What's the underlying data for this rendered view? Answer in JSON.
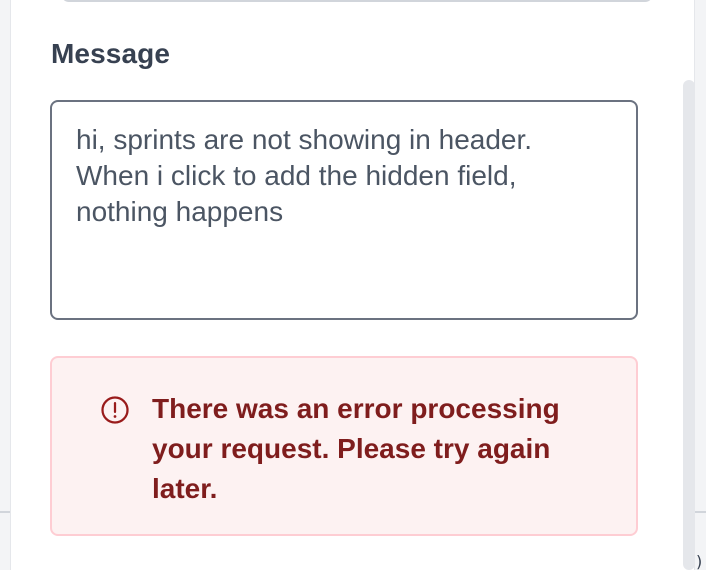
{
  "message_field": {
    "label": "Message",
    "value": "hi, sprints are not showing in header. When i click to add the hidden field, nothing happens"
  },
  "error_alert": {
    "text": "There was an error processing your request. Please try again later.",
    "icon": "exclamation-circle-icon",
    "text_color": "#7f1d1d",
    "background_color": "#fdf2f2",
    "border_color": "#fecdd3"
  },
  "colors": {
    "panel_background": "#ffffff",
    "label_color": "#374151",
    "textarea_border": "#6b7280",
    "scrollbar_track": "#e5e7eb"
  }
}
